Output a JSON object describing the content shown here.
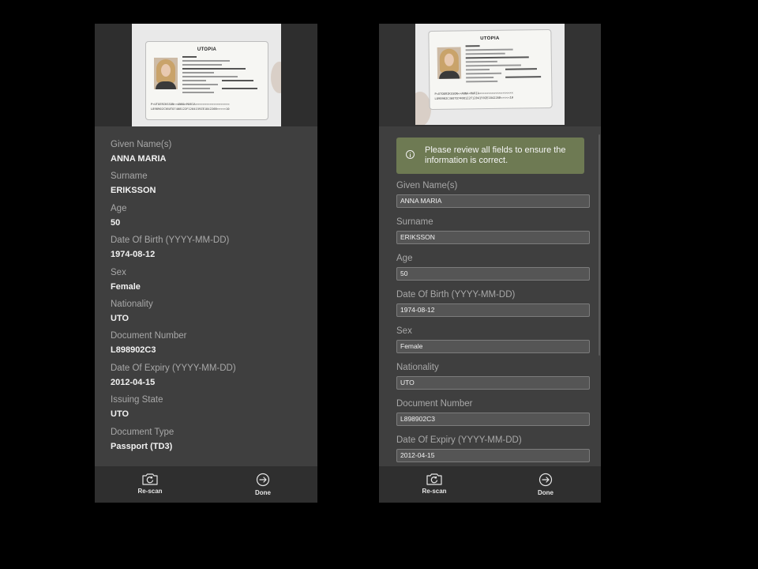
{
  "document_photo": {
    "country": "UTOPIA",
    "mrz_line_1": "P<UTOERIKSSON<<ANNA<MARIA<<<<<<<<<<<<<<<<<<<",
    "mrz_line_2": "L898902C36UTO7408122F1204159ZE184226B<<<<<10"
  },
  "left_screen": {
    "fields": [
      {
        "label": "Given Name(s)",
        "value": "ANNA MARIA"
      },
      {
        "label": "Surname",
        "value": "ERIKSSON"
      },
      {
        "label": "Age",
        "value": "50"
      },
      {
        "label": "Date Of Birth (YYYY-MM-DD)",
        "value": "1974-08-12"
      },
      {
        "label": "Sex",
        "value": "Female"
      },
      {
        "label": "Nationality",
        "value": "UTO"
      },
      {
        "label": "Document Number",
        "value": "L898902C3"
      },
      {
        "label": "Date Of Expiry (YYYY-MM-DD)",
        "value": "2012-04-15"
      },
      {
        "label": "Issuing State",
        "value": "UTO"
      },
      {
        "label": "Document Type",
        "value": "Passport (TD3)"
      }
    ],
    "footer": {
      "rescan_label": "Re-scan",
      "done_label": "Done"
    }
  },
  "right_screen": {
    "banner": {
      "text": "Please review all fields to ensure the information is correct.",
      "icon": "info-icon",
      "color": "#6e7a53"
    },
    "fields": [
      {
        "label": "Given Name(s)",
        "value": "ANNA MARIA"
      },
      {
        "label": "Surname",
        "value": "ERIKSSON"
      },
      {
        "label": "Age",
        "value": "50"
      },
      {
        "label": "Date Of Birth (YYYY-MM-DD)",
        "value": "1974-08-12"
      },
      {
        "label": "Sex",
        "value": "Female"
      },
      {
        "label": "Nationality",
        "value": "UTO"
      },
      {
        "label": "Document Number",
        "value": "L898902C3"
      },
      {
        "label": "Date Of Expiry (YYYY-MM-DD)",
        "value": "2012-04-15"
      }
    ],
    "footer": {
      "rescan_label": "Re-scan",
      "done_label": "Done"
    }
  },
  "icons": {
    "rescan": "camera-rotate-icon",
    "done": "arrow-circle-right-icon"
  }
}
